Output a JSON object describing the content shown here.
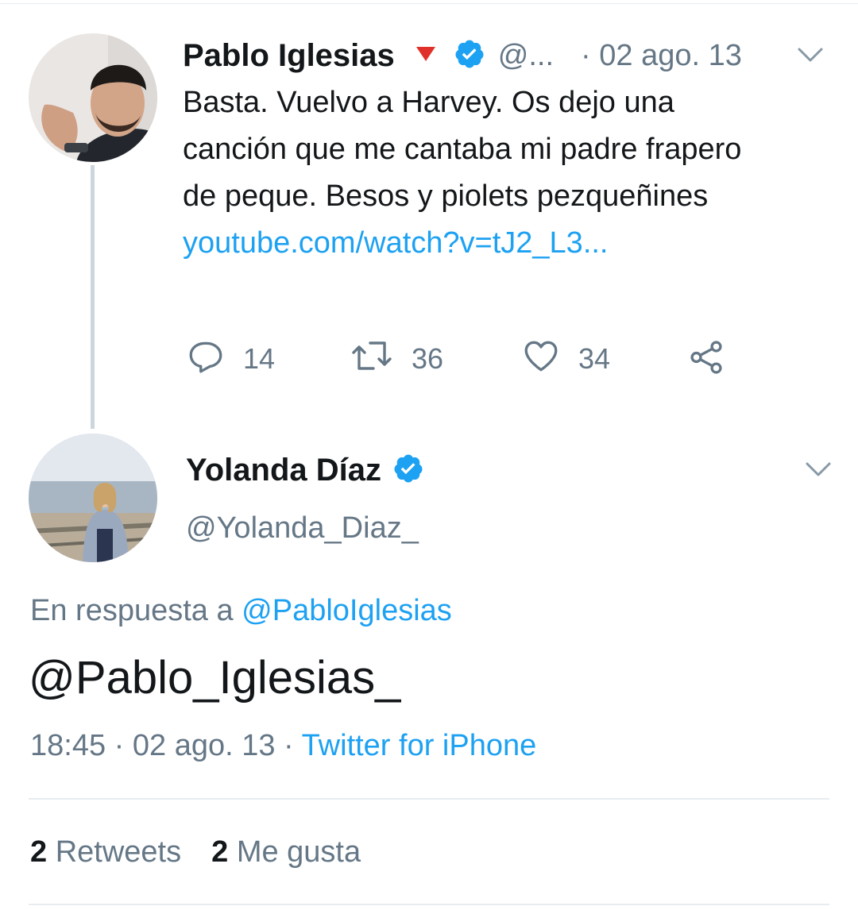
{
  "parent_tweet": {
    "author_name": "Pablo Iglesias",
    "flag_glyph": "🔻",
    "handle": "@...",
    "date": "· 02 ago. 13",
    "text_before_link": "Basta. Vuelvo a Harvey. Os dejo una canción que me cantaba mi padre frapero de peque. Besos y piolets pezqueñines ",
    "link_text": "youtube.com/watch?v=tJ2_L3...",
    "actions": {
      "reply_count": "14",
      "retweet_count": "36",
      "like_count": "34"
    },
    "icons": [
      "avatar-photo",
      "verified-badge-icon",
      "chevron-down-icon",
      "reply-icon",
      "retweet-icon",
      "heart-icon",
      "share-icon"
    ]
  },
  "reply_tweet": {
    "author_name": "Yolanda Díaz",
    "handle": "@Yolanda_Diaz_",
    "in_reply_prefix": "En respuesta a ",
    "in_reply_handle": "@PabloIglesias",
    "text": "@Pablo_Iglesias_",
    "time": "18:45",
    "date": " · 02 ago. 13 · ",
    "source": "Twitter for iPhone",
    "stats": {
      "retweets_count": "2",
      "retweets_label": "Retweets",
      "likes_count": "2",
      "likes_label": "Me gusta"
    }
  },
  "colors": {
    "link": "#1da1f2",
    "muted": "#657786",
    "text": "#14171a",
    "border": "#e6ecf0"
  }
}
